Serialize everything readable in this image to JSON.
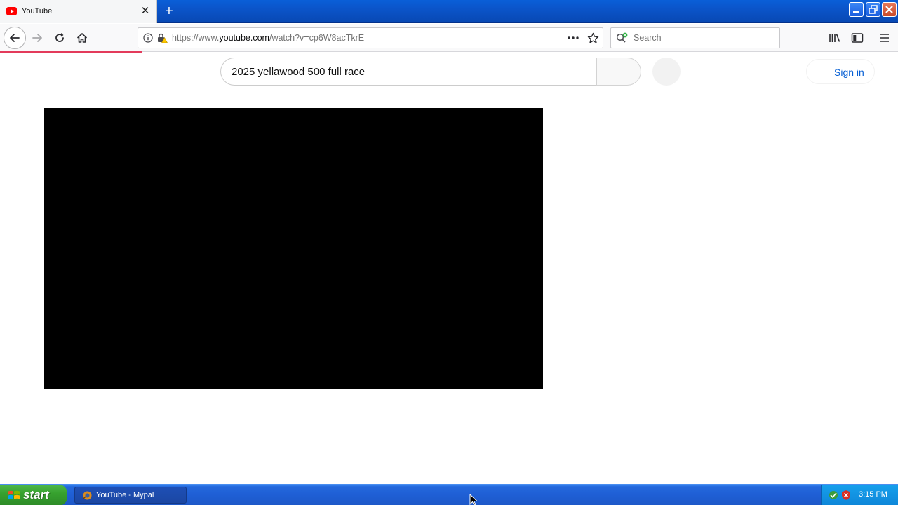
{
  "browser": {
    "tab": {
      "title": "YouTube"
    },
    "url": {
      "prefix": "https://www.",
      "host": "youtube.com",
      "path": "/watch?v=cp6W8acTkrE"
    },
    "search_placeholder": "Search"
  },
  "youtube": {
    "search_query": "2025 yellawood 500 full race",
    "sign_in_label": "Sign in"
  },
  "taskbar": {
    "start_label": "start",
    "task_label": "YouTube - Mypal",
    "clock": "3:15 PM"
  },
  "colors": {
    "youtube_red": "#ff0000",
    "link_blue": "#065fd4",
    "xp_blue": "#1f5fd5",
    "start_green": "#37a22f",
    "progress_red": "#e33b5b"
  }
}
